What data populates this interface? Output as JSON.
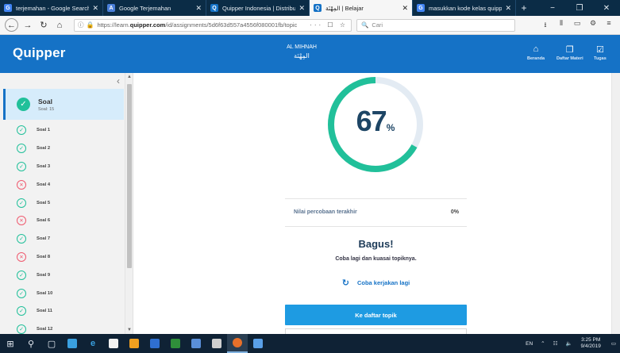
{
  "browser": {
    "tabs": [
      {
        "label": "terjemahan - Google Search",
        "icon": "google-icon",
        "color": "#4285f4",
        "active": false
      },
      {
        "label": "Google Terjemahan",
        "icon": "translate-icon",
        "color": "#4a7fd9",
        "active": false
      },
      {
        "label": "Quipper Indonesia | Distributo",
        "icon": "quipper-icon",
        "color": "#1572c6",
        "active": false
      },
      {
        "label": "المِهْنَة | Belajar",
        "icon": "quipper-icon",
        "color": "#1572c6",
        "active": true
      },
      {
        "label": "masukkan kode kelas quipper",
        "icon": "google-icon",
        "color": "#4285f4",
        "active": false
      }
    ],
    "url_prefix": "https://learn.",
    "url_domain": "quipper.com",
    "url_rest": "/id/assignments/5d6f63d557a4556f080001fb/topic",
    "search_placeholder": "Cari"
  },
  "header": {
    "brand": "Quipper",
    "course_title": "AL MIHNAH",
    "course_arabic": "المِهْنَة",
    "nav": [
      {
        "label": "Beranda",
        "icon": "home-icon",
        "glyph": "⌂"
      },
      {
        "label": "Daftar Materi",
        "icon": "materials-icon",
        "glyph": "❐"
      },
      {
        "label": "Tugas",
        "icon": "assignment-icon",
        "glyph": "☑"
      }
    ]
  },
  "sidebar": {
    "header_title": "Soal",
    "header_sub": "Soal: 15",
    "items": [
      {
        "label": "Soal 1",
        "status": "correct"
      },
      {
        "label": "Soal 2",
        "status": "correct"
      },
      {
        "label": "Soal 3",
        "status": "correct"
      },
      {
        "label": "Soal 4",
        "status": "wrong"
      },
      {
        "label": "Soal 5",
        "status": "correct"
      },
      {
        "label": "Soal 6",
        "status": "wrong"
      },
      {
        "label": "Soal 7",
        "status": "correct"
      },
      {
        "label": "Soal 8",
        "status": "wrong"
      },
      {
        "label": "Soal 9",
        "status": "correct"
      },
      {
        "label": "Soal 10",
        "status": "correct"
      },
      {
        "label": "Soal 11",
        "status": "correct"
      },
      {
        "label": "Soal 12",
        "status": "correct"
      }
    ]
  },
  "result": {
    "score": "67",
    "score_unit": "%",
    "progress": 0.67,
    "last_attempt_label": "Nilai percobaan terakhir",
    "last_attempt_value": "0%",
    "verdict": "Bagus!",
    "message": "Coba lagi dan kuasai topiknya.",
    "retry_label": "Coba kerjakan lagi",
    "topics_button": "Ke daftar topik"
  },
  "taskbar": {
    "lang": "EN",
    "time": "3:25 PM",
    "date": "9/4/2019"
  },
  "colors": {
    "brand_blue": "#1572c6",
    "ring_teal": "#21c09a",
    "ring_track": "#e3ebf3",
    "wrong_red": "#ef5a6f",
    "button_blue": "#1e9be2"
  }
}
